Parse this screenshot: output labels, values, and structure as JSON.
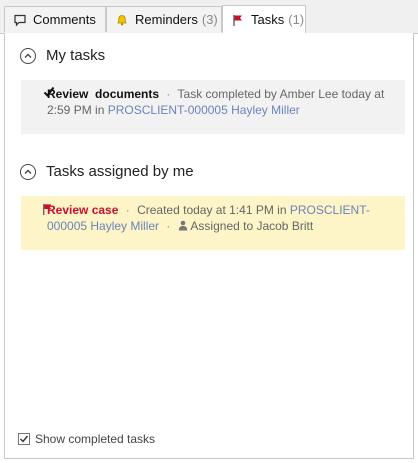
{
  "tabs": [
    {
      "label": "Comments",
      "count": "",
      "icon": "comment-icon",
      "active": false
    },
    {
      "label": "Reminders",
      "count": "(3)",
      "icon": "bell-icon",
      "active": false
    },
    {
      "label": "Tasks",
      "count": "(1)",
      "icon": "flag-icon",
      "active": true
    }
  ],
  "my_tasks": {
    "title": "My tasks",
    "items": [
      {
        "status_icon": "checkmark-icon",
        "title": "Review",
        "title_tail": "documents",
        "separator": "·",
        "meta": "Task completed by Amber Lee today at 2:59 PM in",
        "link": "PROSCLIENT-000005 Hayley Miller"
      }
    ]
  },
  "assigned_by_me": {
    "title": "Tasks assigned by me",
    "items": [
      {
        "status_icon": "flag-icon",
        "title": "Review case",
        "separator": "·",
        "meta": "Created today at 1:41 PM in",
        "link": "PROSCLIENT-000005 Hayley Miller",
        "separator2": "·",
        "assignee_icon": "user-icon",
        "assignee": "Assigned to Jacob Britt"
      }
    ]
  },
  "footer": {
    "checkbox_label": "Show completed tasks",
    "checked": true
  },
  "colors": {
    "flag": "#c8102e",
    "link": "#6b84b8",
    "assigned_bg": "#fdf4c7",
    "done_bg": "#f2f2f2"
  }
}
